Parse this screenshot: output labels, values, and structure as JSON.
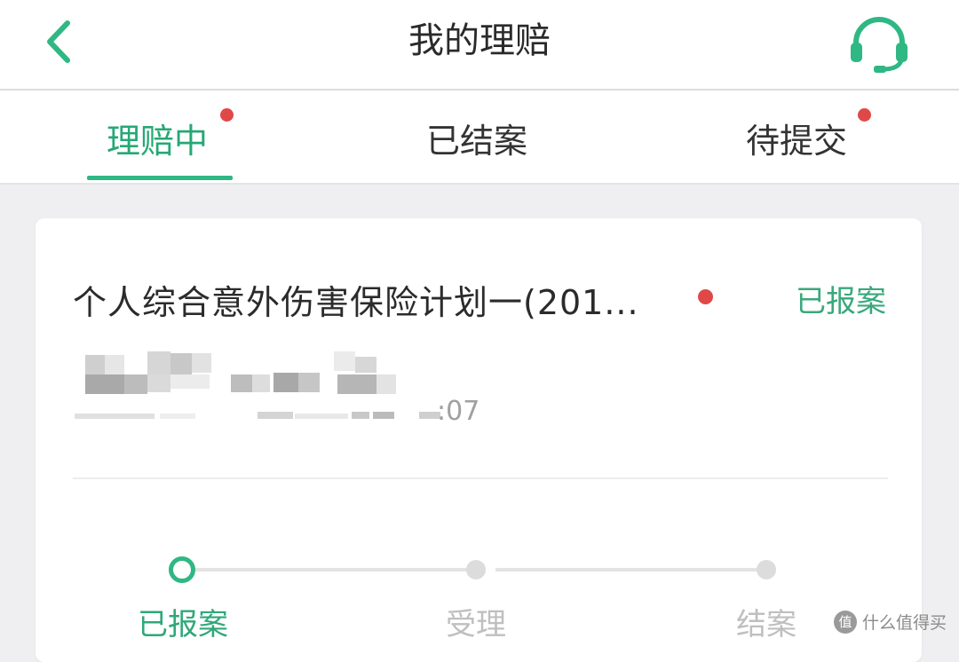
{
  "header": {
    "title": "我的理赔"
  },
  "tabs": [
    {
      "label": "理赔中",
      "active": true,
      "has_dot": true
    },
    {
      "label": "已结案",
      "active": false,
      "has_dot": false
    },
    {
      "label": "待提交",
      "active": false,
      "has_dot": true
    }
  ],
  "claim_card": {
    "policy_name": "个人综合意外伤害保险计划一(201...",
    "status": "已报案",
    "time_suffix": ":07",
    "progress": {
      "steps": [
        {
          "label": "已报案",
          "state": "done"
        },
        {
          "label": "受理",
          "state": "pending"
        },
        {
          "label": "结案",
          "state": "pending"
        }
      ]
    }
  },
  "watermark": {
    "icon": "值",
    "text": "什么值得买"
  },
  "colors": {
    "accent": "#2fb784",
    "accent_text": "#26a874",
    "red_dot": "#e04848",
    "background": "#efeff1"
  },
  "icons": {
    "back": "chevron-left-icon",
    "service": "headset-icon"
  }
}
